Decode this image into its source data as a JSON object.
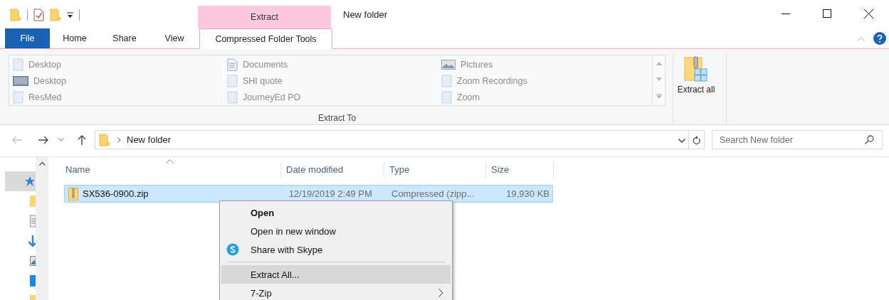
{
  "window": {
    "title": "New folder"
  },
  "contextual_tab_header": "Extract",
  "ribbon_tabs": [
    {
      "label": "File",
      "kind": "file",
      "selected": false
    },
    {
      "label": "Home",
      "kind": "tab",
      "selected": false
    },
    {
      "label": "Share",
      "kind": "tab",
      "selected": false
    },
    {
      "label": "View",
      "kind": "tab",
      "selected": false
    },
    {
      "label": "Compressed Folder Tools",
      "kind": "contextual",
      "selected": true
    }
  ],
  "extract_to": {
    "label": "Extract To",
    "columns": [
      [
        {
          "label": "Desktop",
          "kind": "file"
        },
        {
          "label": "Desktop",
          "kind": "monitor"
        },
        {
          "label": "ResMed",
          "kind": "file"
        }
      ],
      [
        {
          "label": "Documents",
          "kind": "document"
        },
        {
          "label": "SHI quote",
          "kind": "file"
        },
        {
          "label": "JourneyEd PO",
          "kind": "file"
        }
      ],
      [
        {
          "label": "Pictures",
          "kind": "picture"
        },
        {
          "label": "Zoom Recordings",
          "kind": "file"
        },
        {
          "label": "Zoom",
          "kind": "file"
        }
      ]
    ]
  },
  "extract_all_button": {
    "label": "Extract all"
  },
  "address_bar": {
    "path": "New folder"
  },
  "search": {
    "placeholder": "Search New folder"
  },
  "nav_pane": {
    "items": [
      {
        "kind": "star",
        "selected": true
      },
      {
        "kind": "folder",
        "selected": false
      },
      {
        "kind": "document",
        "selected": false
      },
      {
        "kind": "arrow",
        "selected": false
      },
      {
        "kind": "picture",
        "selected": false
      },
      {
        "kind": "device",
        "selected": false
      },
      {
        "kind": "folder",
        "selected": false
      }
    ]
  },
  "file_list": {
    "columns": [
      "Name",
      "Date modified",
      "Type",
      "Size"
    ],
    "rows": [
      {
        "name": "SX536-0900.zip",
        "date_modified": "12/19/2019 2:49 PM",
        "type": "Compressed (zipp...",
        "size": "19,930 KB",
        "selected": true
      }
    ]
  },
  "context_menu": [
    {
      "kind": "item",
      "label": "Open",
      "default": true,
      "selected": false
    },
    {
      "kind": "item",
      "label": "Open in new window",
      "default": false,
      "selected": false
    },
    {
      "kind": "icon",
      "label": "Share with Skype",
      "default": false,
      "selected": false
    },
    {
      "kind": "separator"
    },
    {
      "kind": "item",
      "label": "Extract All...",
      "default": false,
      "selected": true
    },
    {
      "kind": "submenu",
      "label": "7-Zip",
      "default": false,
      "selected": false
    }
  ]
}
